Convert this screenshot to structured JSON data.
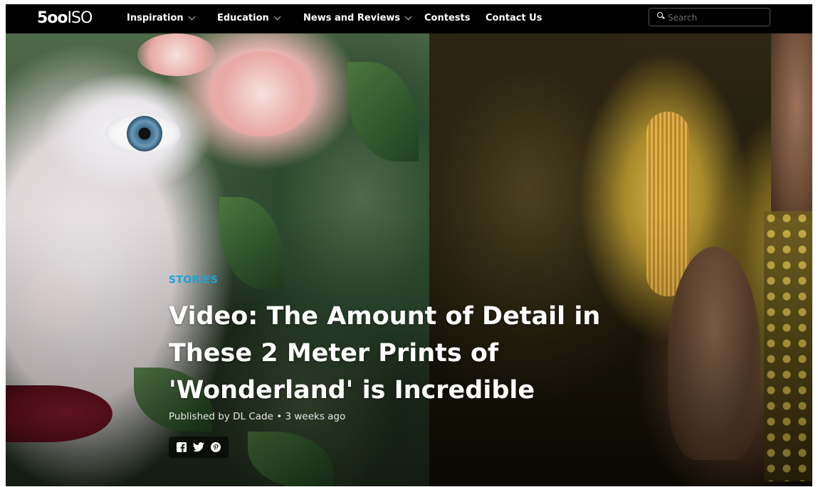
{
  "nav": {
    "logo_bold": "5oo",
    "logo_light": "ISO",
    "items": [
      {
        "label": "Inspiration",
        "dropdown": true
      },
      {
        "label": "Education",
        "dropdown": true
      },
      {
        "label": "News and Reviews",
        "dropdown": true
      },
      {
        "label": "Contests",
        "dropdown": false
      },
      {
        "label": "Contact Us",
        "dropdown": false
      }
    ],
    "search_placeholder": "Search"
  },
  "article": {
    "category": "STORIES",
    "title": "Video: The Amount of Detail in These 2 Meter Prints of 'Wonderland' is Incredible",
    "byline": "Published by DL Cade • 3 weeks ago",
    "share_icons": [
      "facebook-icon",
      "twitter-icon",
      "pinterest-icon"
    ]
  },
  "colors": {
    "nav_bg": "#000000",
    "accent": "#1aa3dc",
    "title_text": "#ffffff"
  }
}
